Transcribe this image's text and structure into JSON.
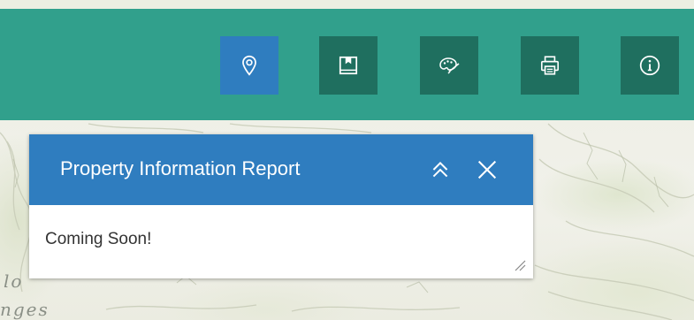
{
  "header": {
    "background": "#31a08c",
    "tools": [
      {
        "icon": "location-pin-icon",
        "active": true
      },
      {
        "icon": "bookmark-icon",
        "active": false
      },
      {
        "icon": "palette-icon",
        "active": false
      },
      {
        "icon": "printer-icon",
        "active": false
      },
      {
        "icon": "info-icon",
        "active": false
      }
    ]
  },
  "panel": {
    "title": "Property Information Report",
    "body_text": "Coming Soon!",
    "header_color": "#2f7dbf",
    "collapse_icon": "double-chevron-up-icon",
    "close_icon": "close-icon"
  },
  "map": {
    "labels": [
      "lo",
      "nges"
    ]
  }
}
